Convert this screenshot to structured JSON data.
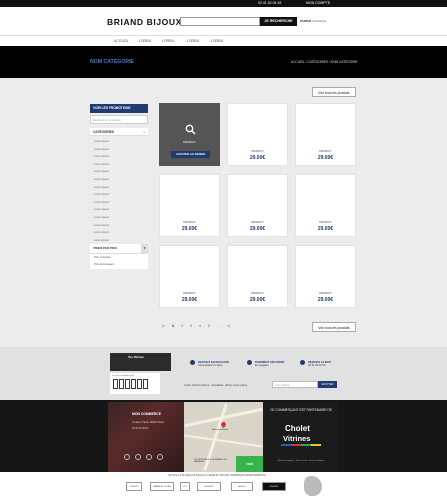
{
  "topbar": {
    "phone": "02 41 62 04 63",
    "account": "MON COMPTE"
  },
  "header": {
    "brand": "BRIAND BIJOUX",
    "search_placeholder": "",
    "search_button": "JE RECHERCHE",
    "cart_label": "PANIER",
    "cart_count": "0 article(s)"
  },
  "nav": {
    "items": [
      "ACCUEIL",
      "LOREM",
      "LOREM",
      "LOREM",
      "LOREM"
    ]
  },
  "banner": {
    "title": "NOM CATÉGORIE",
    "breadcrumb": "ACCUEIL / CATÉGORIES / NOM CATÉGORIE"
  },
  "toolbar": {
    "see_all": "Voir tous les produits"
  },
  "sidebar": {
    "promo": "VOIR LES PROMOTIONS",
    "search_placeholder": "Rechercher un produit",
    "categories_title": "CATÉGORIES",
    "categories": [
      "Lorem ipsum",
      "Lorem ipsum",
      "Lorem ipsum",
      "Lorem ipsum",
      "Lorem ipsum",
      "Lorem ipsum",
      "Lorem ipsum",
      "Lorem ipsum",
      "Lorem ipsum",
      "Lorem ipsum",
      "Lorem ipsum",
      "Lorem ipsum",
      "Lorem ipsum",
      "Lorem ipsum"
    ],
    "sort_title": "TRIER PAR PRIX",
    "sort_options": [
      "Prix croissant",
      "Prix décroissant"
    ]
  },
  "products": [
    {
      "label": "PRODUIT",
      "price": "",
      "hover": true,
      "add_label": "AJOUTER AU PANIER"
    },
    {
      "label": "PRODUIT",
      "price": "29.00€"
    },
    {
      "label": "PRODUIT",
      "price": "29.00€"
    },
    {
      "label": "PRODUIT",
      "price": "29.00€"
    },
    {
      "label": "PRODUIT",
      "price": "29.00€"
    },
    {
      "label": "PRODUIT",
      "price": "29.00€"
    },
    {
      "label": "PRODUIT",
      "price": "29.00€"
    },
    {
      "label": "PRODUIT",
      "price": "29.00€"
    },
    {
      "label": "PRODUIT",
      "price": "29.00€"
    }
  ],
  "pagination": {
    "pages": [
      "1",
      "2",
      "3",
      "4",
      "5",
      "..."
    ],
    "prev": "|<",
    "next": ">|"
  },
  "features": {
    "withdraw_title": "RETRAIT EN MAGASIN",
    "withdraw_text": "Commandez en ligne",
    "payment_title": "PAIEMENT SÉCURISÉ",
    "payment_text": "En magasin",
    "service_title": "SERVICE CLIENT",
    "service_text": "02 41 62 04 63"
  },
  "vitrine": {
    "banner": "Vos Vitrines",
    "caption": "Ce site est financé par"
  },
  "newsletter": {
    "label": "Lettre d'informations : actualités, offres, bons plans...",
    "placeholder": "votre email ici",
    "button": "ENVOYER"
  },
  "shop": {
    "title": "MON COMMERCE",
    "address": "12 place Travot, 49300 Cholet",
    "phone": "02 41 62 04 63"
  },
  "map": {
    "label": "Bijouterie Briand",
    "hours": "OUVERTURES & HORAIRES DU MAGASIN",
    "go": "VOIR"
  },
  "partner": {
    "headline": "CE COMMERÇANT EST PARTENAIRE DE",
    "logo_line1": "Cholet",
    "logo_line2": "Vitrines",
    "small": "Mentions légales · Plan du site · Nous contacter",
    "colors": {
      "blue": "#1f5fbf",
      "red": "#d92f2f",
      "green": "#2fa84f",
      "yellow": "#f2c22e"
    }
  },
  "bottom": {
    "text": "CE SITE A ÉTÉ RÉALISÉ DANS LE CADRE DU PROJET NUMÉRIQUE DÉPARTEMENTAL",
    "sponsors": [
      "CHOLET",
      "MAINE ET LOIRE",
      "CCI",
      "REGION",
      "AGGLO",
      "CHOLET"
    ]
  },
  "colors": {
    "accent": "#1f3b70",
    "dark": "#111111",
    "banner_title": "#4c79c5"
  }
}
